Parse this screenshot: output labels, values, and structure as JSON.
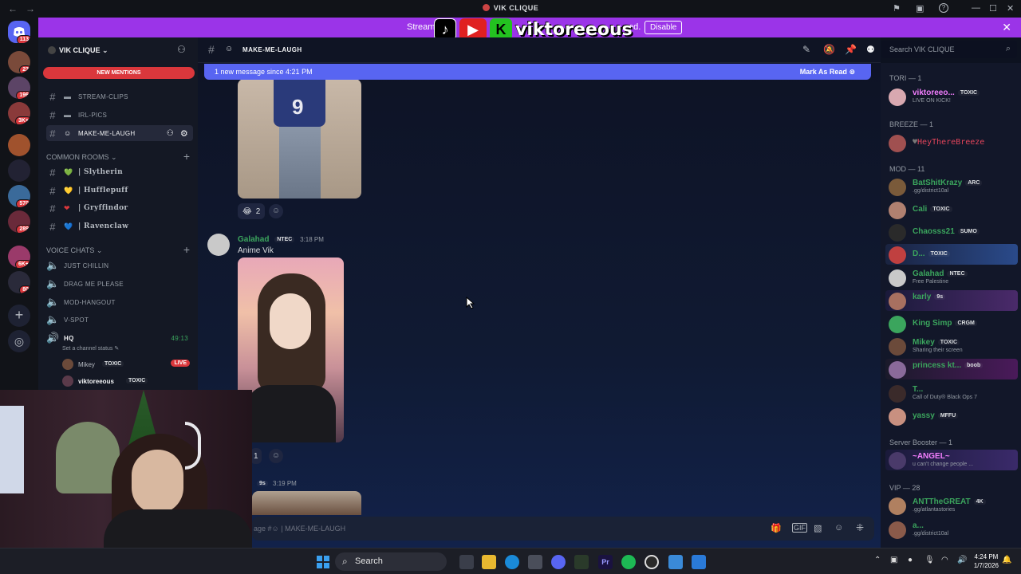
{
  "titlebar": {
    "title": "VIK CLIQUE",
    "back": "←",
    "forward": "→"
  },
  "rail": {
    "badges": [
      "113",
      "23",
      "196",
      "3K+",
      "570",
      "289",
      "6K+",
      "80"
    ]
  },
  "banner": {
    "text_visible": "Streame",
    "text_tail": "ed.",
    "disable_label": "Disable",
    "logo_text": "viktoreeous",
    "k_letter": "K"
  },
  "sidebar": {
    "server_name": "VIK CLIQUE",
    "new_mentions": "NEW MENTIONS",
    "channels": [
      {
        "name": "STREAM-CLIPS"
      },
      {
        "name": "IRL-PICS"
      },
      {
        "name": "MAKE-ME-LAUGH"
      }
    ],
    "common_rooms_label": "COMMON ROOMS",
    "common_rooms": [
      {
        "name": "| Slytherin",
        "heart": "💚"
      },
      {
        "name": "| Hufflepuff",
        "heart": "💛"
      },
      {
        "name": "| Gryffindor",
        "heart": "❤"
      },
      {
        "name": "| Ravenclaw",
        "heart": "💙"
      }
    ],
    "voice_label": "VOICE CHATS",
    "voice": [
      "JUST CHILLIN",
      "DRAG ME PLEASE",
      "MOD-HANGOUT",
      "V-SPOT"
    ],
    "hq": {
      "name": "HQ",
      "time": "49:13",
      "status": "Set a channel status"
    },
    "hq_users": [
      {
        "name": "Mikey",
        "tag": "TOXIC",
        "live": "LIVE"
      },
      {
        "name": "viktoreeous",
        "tag": "TOXIC"
      }
    ]
  },
  "chat": {
    "channel_name": "MAKE-ME-LAUGH",
    "new_message_text": "1 new message since 4:21 PM",
    "mark_read": "Mark As Read",
    "reaction1_count": "2",
    "msg2": {
      "author": "Galahad",
      "tag": "NTEC",
      "time": "3:18 PM",
      "text": "Anime Vik",
      "reaction_count": "1"
    },
    "msg3": {
      "tag": "9s",
      "time": "3:19 PM"
    },
    "composer_placeholder": "MAKE-ME-LAUGH",
    "composer_prefix": "age #"
  },
  "search": {
    "placeholder": "Search VIK CLIQUE"
  },
  "members": {
    "groups": [
      {
        "label": "TORI — 1"
      },
      {
        "label": "BREEZE — 1"
      },
      {
        "label": "MOD — 11"
      },
      {
        "label": "Server Booster — 1"
      },
      {
        "label": "VIP — 28"
      }
    ],
    "list": [
      {
        "name": "viktoreeo...",
        "tag": "TOXIC",
        "sub": "LIVE ON KICK!",
        "color": "#f47fff"
      },
      {
        "name": "HeyThereBreeze",
        "tag": "",
        "sub": "",
        "color": "#e0445a"
      },
      {
        "name": "BatShitKrazy",
        "tag": "ARC",
        "sub": ".gg/district10al",
        "color": "#3ba55d"
      },
      {
        "name": "Cali",
        "tag": "TOXIC",
        "sub": "",
        "color": "#3ba55d"
      },
      {
        "name": "Chaosss21",
        "tag": "SUMO",
        "sub": "",
        "color": "#3ba55d"
      },
      {
        "name": "D...",
        "tag": "TOXIC",
        "sub": "",
        "color": "#3ba55d"
      },
      {
        "name": "Galahad",
        "tag": "NTEC",
        "sub": "Free Palestine",
        "color": "#3ba55d"
      },
      {
        "name": "karly",
        "tag": "9s",
        "sub": "",
        "color": "#3ba55d"
      },
      {
        "name": "King Simp",
        "tag": "CRGM",
        "sub": "",
        "color": "#3ba55d"
      },
      {
        "name": "Mikey",
        "tag": "TOXIC",
        "sub": "Sharing their screen",
        "color": "#3ba55d"
      },
      {
        "name": "princess kt...",
        "tag": "boob",
        "sub": "",
        "color": "#3ba55d"
      },
      {
        "name": "T...",
        "tag": "",
        "sub": "Call of Duty® Black Ops 7",
        "color": "#3ba55d"
      },
      {
        "name": "yassy",
        "tag": "MFFU",
        "sub": "",
        "color": "#3ba55d"
      },
      {
        "name": "~ANGEL~",
        "tag": "",
        "sub": "u can't change people ...",
        "color": "#f47fff"
      },
      {
        "name": "ANTTheGREAT",
        "tag": "4K",
        "sub": ".gg/atlantastories",
        "color": "#3ba55d"
      },
      {
        "name": "a...",
        "tag": "",
        "sub": ".gg/district10al",
        "color": "#3ba55d"
      }
    ]
  },
  "taskbar": {
    "search": "Search",
    "time": "4:24 PM",
    "date": "1/7/2026"
  }
}
